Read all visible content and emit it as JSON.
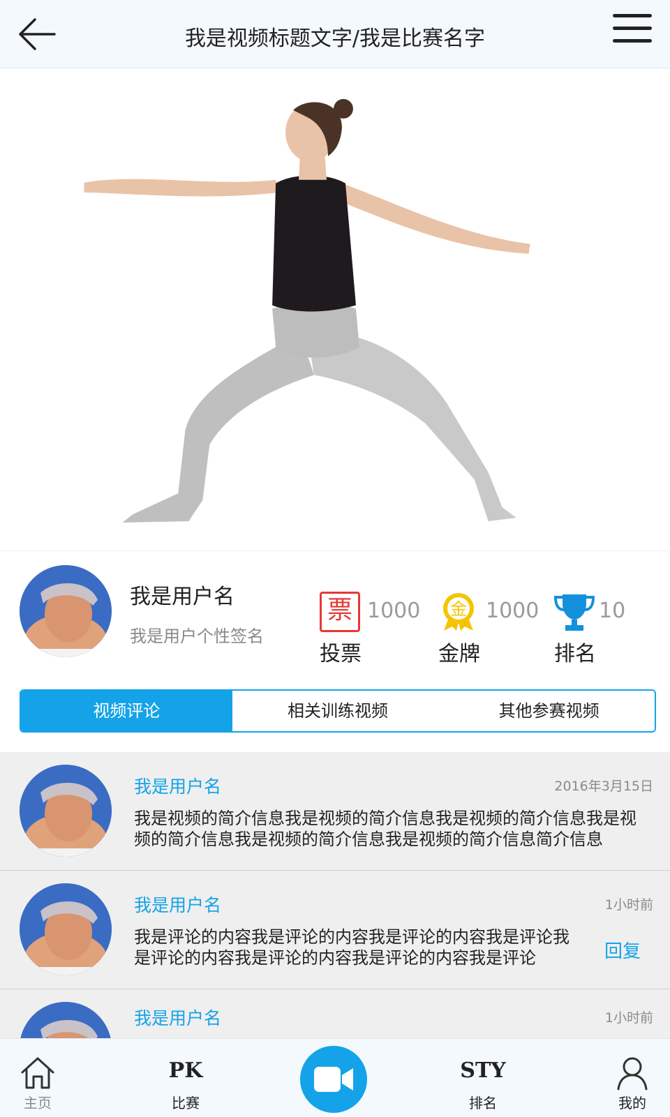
{
  "header": {
    "title": "我是视频标题文字/我是比赛名字",
    "back_icon": "arrow-left-icon",
    "menu_icon": "hamburger-menu-icon"
  },
  "profile": {
    "username": "我是用户名",
    "signature": "我是用户个性签名",
    "stats": {
      "votes": {
        "value": "1000",
        "label": "投票",
        "icon": "ticket-icon",
        "icon_text": "票"
      },
      "gold": {
        "value": "1000",
        "label": "金牌",
        "icon": "gold-medal-icon",
        "icon_text": "金"
      },
      "rank": {
        "value": "10",
        "label": "排名",
        "icon": "trophy-icon"
      }
    }
  },
  "tabs": [
    {
      "label": "视频评论",
      "active": true
    },
    {
      "label": "相关训练视频",
      "active": false
    },
    {
      "label": "其他参赛视频",
      "active": false
    }
  ],
  "comments": [
    {
      "user": "我是用户名",
      "time": "2016年3月15日",
      "text": "我是视频的简介信息我是视频的简介信息我是视频的简介信息我是视频的简介信息我是视频的简介信息我是视频的简介信息简介信息"
    },
    {
      "user": "我是用户名",
      "time": "1小时前",
      "text": "我是评论的内容我是评论的内容我是评论的内容我是评论我是评论的内容我是评论的内容我是评论的内容我是评论",
      "reply": "回复"
    },
    {
      "user": "我是用户名",
      "time": "1小时前",
      "text": ""
    }
  ],
  "bottom_nav": {
    "home": {
      "label": "主页",
      "icon": "home-icon"
    },
    "pk": {
      "label": "比赛",
      "glyph": "PK"
    },
    "record": {
      "icon": "video-camera-icon"
    },
    "rank": {
      "label": "排名",
      "glyph": "STY"
    },
    "me": {
      "label": "我的",
      "icon": "user-icon"
    }
  },
  "colors": {
    "accent": "#14a3e8",
    "header_bg": "#f3f9fd",
    "comment_bg": "#efefef",
    "ticket_red": "#e53935",
    "medal_gold": "#f5c400"
  }
}
